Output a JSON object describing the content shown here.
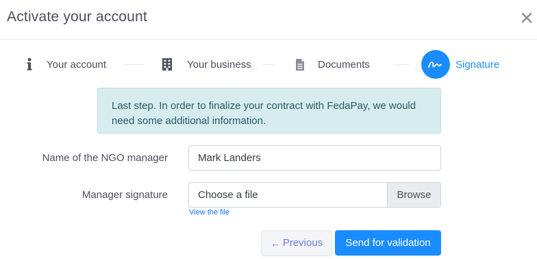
{
  "modal": {
    "title": "Activate your account",
    "close_icon": "close-icon"
  },
  "steps": [
    {
      "label": "Your account",
      "icon": "info-icon",
      "active": false
    },
    {
      "label": "Your business",
      "icon": "building-icon",
      "active": false
    },
    {
      "label": "Documents",
      "icon": "document-icon",
      "active": false
    },
    {
      "label": "Signature",
      "icon": "signature-icon",
      "active": true
    }
  ],
  "alert": {
    "text": "Last step. In order to finalize your contract with FedaPay, we would need some additional information."
  },
  "form": {
    "manager_name": {
      "label": "Name of the NGO manager",
      "value": "Mark Landers"
    },
    "manager_signature": {
      "label": "Manager signature",
      "placeholder": "Choose a file",
      "browse_label": "Browse",
      "view_link": "View the file"
    }
  },
  "actions": {
    "previous_label": "Previous",
    "send_label": "Send for validation"
  },
  "colors": {
    "accent": "#1a8cff",
    "alert_bg": "#d6ecef",
    "previous_text": "#6c7ae0"
  }
}
